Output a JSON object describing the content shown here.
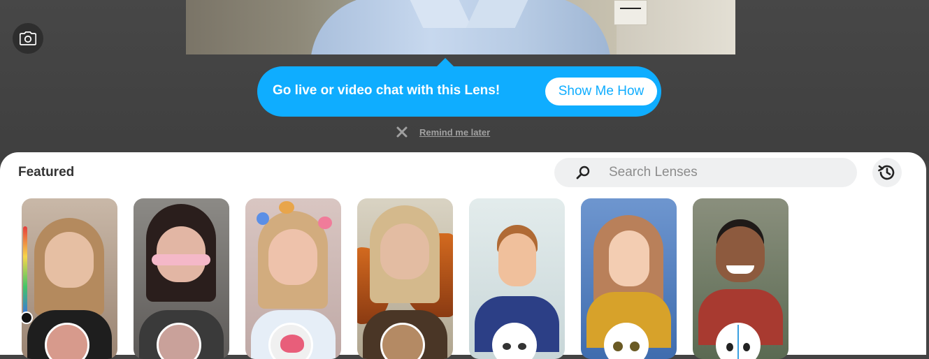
{
  "tooltip": {
    "message": "Go live or video chat with this Lens!",
    "show_me_label": "Show Me How",
    "remind_label": "Remind me later"
  },
  "panel": {
    "title": "Featured",
    "search_placeholder": "Search Lenses"
  },
  "icons": {
    "camera": "camera-icon",
    "close": "close-icon",
    "search": "search-icon",
    "history": "history-icon"
  },
  "colors": {
    "accent": "#0fadff",
    "panel_bg": "#ffffff",
    "camera_bg": "#434343"
  },
  "lenses": [
    {
      "name": "lens-1"
    },
    {
      "name": "lens-2"
    },
    {
      "name": "lens-3"
    },
    {
      "name": "lens-4"
    },
    {
      "name": "lens-5"
    },
    {
      "name": "lens-6"
    },
    {
      "name": "lens-7"
    }
  ]
}
